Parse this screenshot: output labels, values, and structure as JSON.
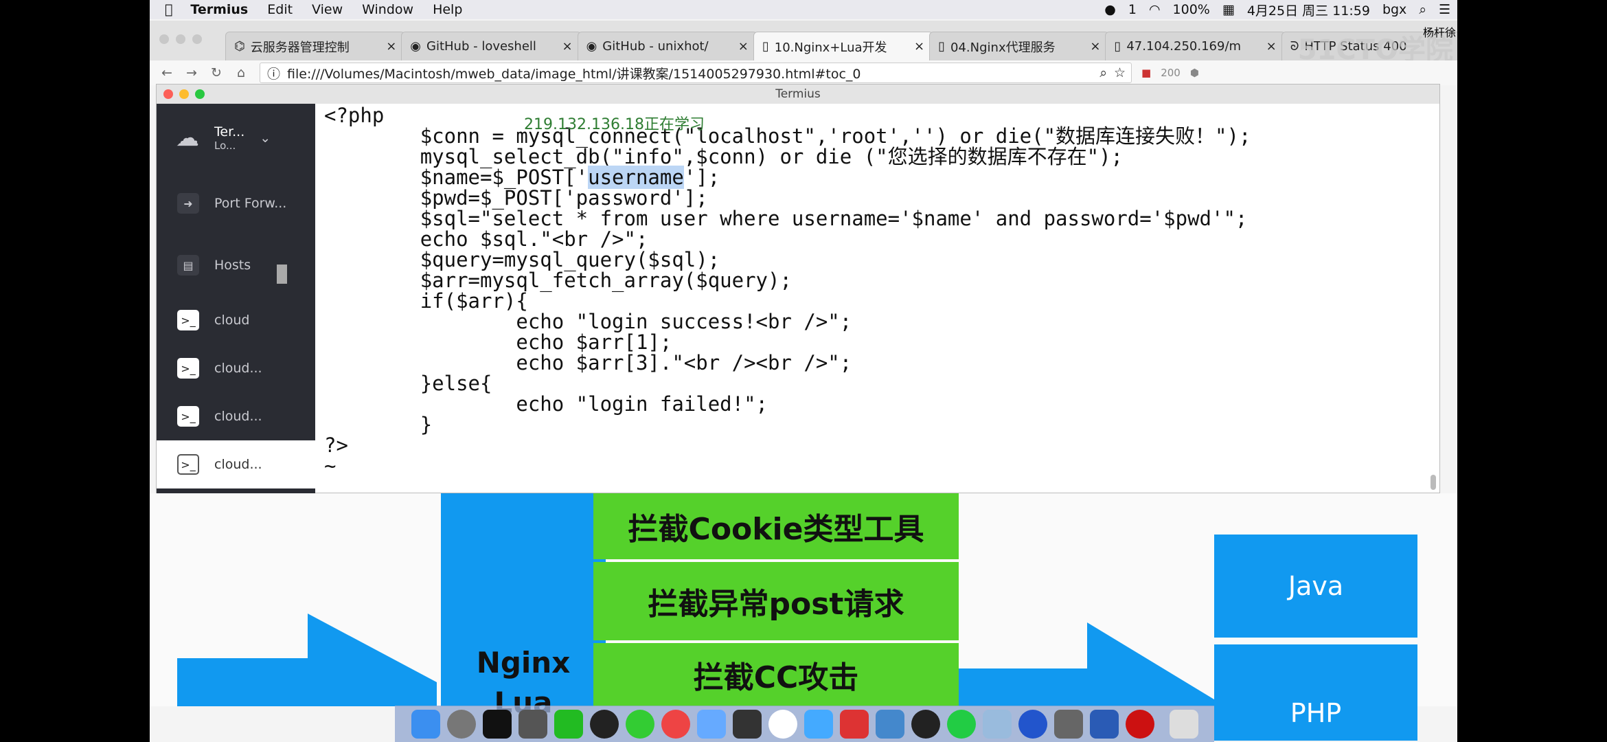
{
  "menubar": {
    "app": "Termius",
    "items": [
      "Edit",
      "View",
      "Window",
      "Help"
    ],
    "notif": "1",
    "battery": "100%",
    "datetime": "4月25日 周三 11:59",
    "user": "bgx"
  },
  "tabs": [
    {
      "label": "云服务器管理控制",
      "icon": "cloud-icon"
    },
    {
      "label": "GitHub - loveshell",
      "icon": "github-icon"
    },
    {
      "label": "GitHub - unixhot/",
      "icon": "github-icon"
    },
    {
      "label": "10.Nginx+Lua开发",
      "icon": "page-icon",
      "active": true
    },
    {
      "label": "04.Nginx代理服务",
      "icon": "page-icon"
    },
    {
      "label": "47.104.250.169/m",
      "icon": "page-icon"
    },
    {
      "label": "HTTP Status 400",
      "icon": "tomcat-icon"
    }
  ],
  "tab_close": "×",
  "extra_tab_text": "杨杆徐",
  "address": {
    "url": "file:///Volumes/Macintosh/mweb_data/image_html/讲课教案/1514005297930.html#toc_0",
    "ext_badge": "200"
  },
  "watermark": "51CTO学院",
  "termius": {
    "title": "Termius",
    "profile": {
      "name": "Ter...",
      "status": "Lo..."
    },
    "nav": [
      {
        "label": "Port Forw...",
        "icon": "arrow-icon"
      },
      {
        "label": "Hosts",
        "icon": "hosts-icon"
      }
    ],
    "hosts": [
      {
        "label": "cloud"
      },
      {
        "label": "cloud..."
      },
      {
        "label": "cloud..."
      },
      {
        "label": "cloud...",
        "selected": true
      }
    ],
    "overlay_watermark": "219.132.136.18正在学习",
    "code": {
      "l0": "<?php",
      "l1a": "\t$conn = mysql_connect(\"localhost\",'root','') or die(\"数据库连接失败！\");",
      "l2": "\tmysql_select_db(\"info\",$conn) or die (\"您选择的数据库不存在\");",
      "l3a": "\t$name=$_POST['",
      "l3b": "username",
      "l3c": "'];",
      "rest": "\t$pwd=$_POST['password'];\n\t$sql=\"select * from user where username='$name' and password='$pwd'\";\n\techo $sql.\"<br />\";\n\t$query=mysql_query($sql);\n\t$arr=mysql_fetch_array($query);\n\tif($arr){\n\t\techo \"login success!<br />\";\n\t\techo $arr[1];\n\t\techo $arr[3].\"<br /><br />\";\n\t}else{\n\t\techo \"login failed!\";\n\t}\n?>\n~"
    }
  },
  "slide": {
    "center_label": "Nginx\nLua",
    "filters": [
      "拦截Cookie类型工具",
      "拦截异常post请求",
      "拦截CC攻击"
    ],
    "backends": [
      "Java",
      "PHP"
    ],
    "colors": {
      "blue": "#1199f0",
      "green": "#55d12b"
    }
  }
}
